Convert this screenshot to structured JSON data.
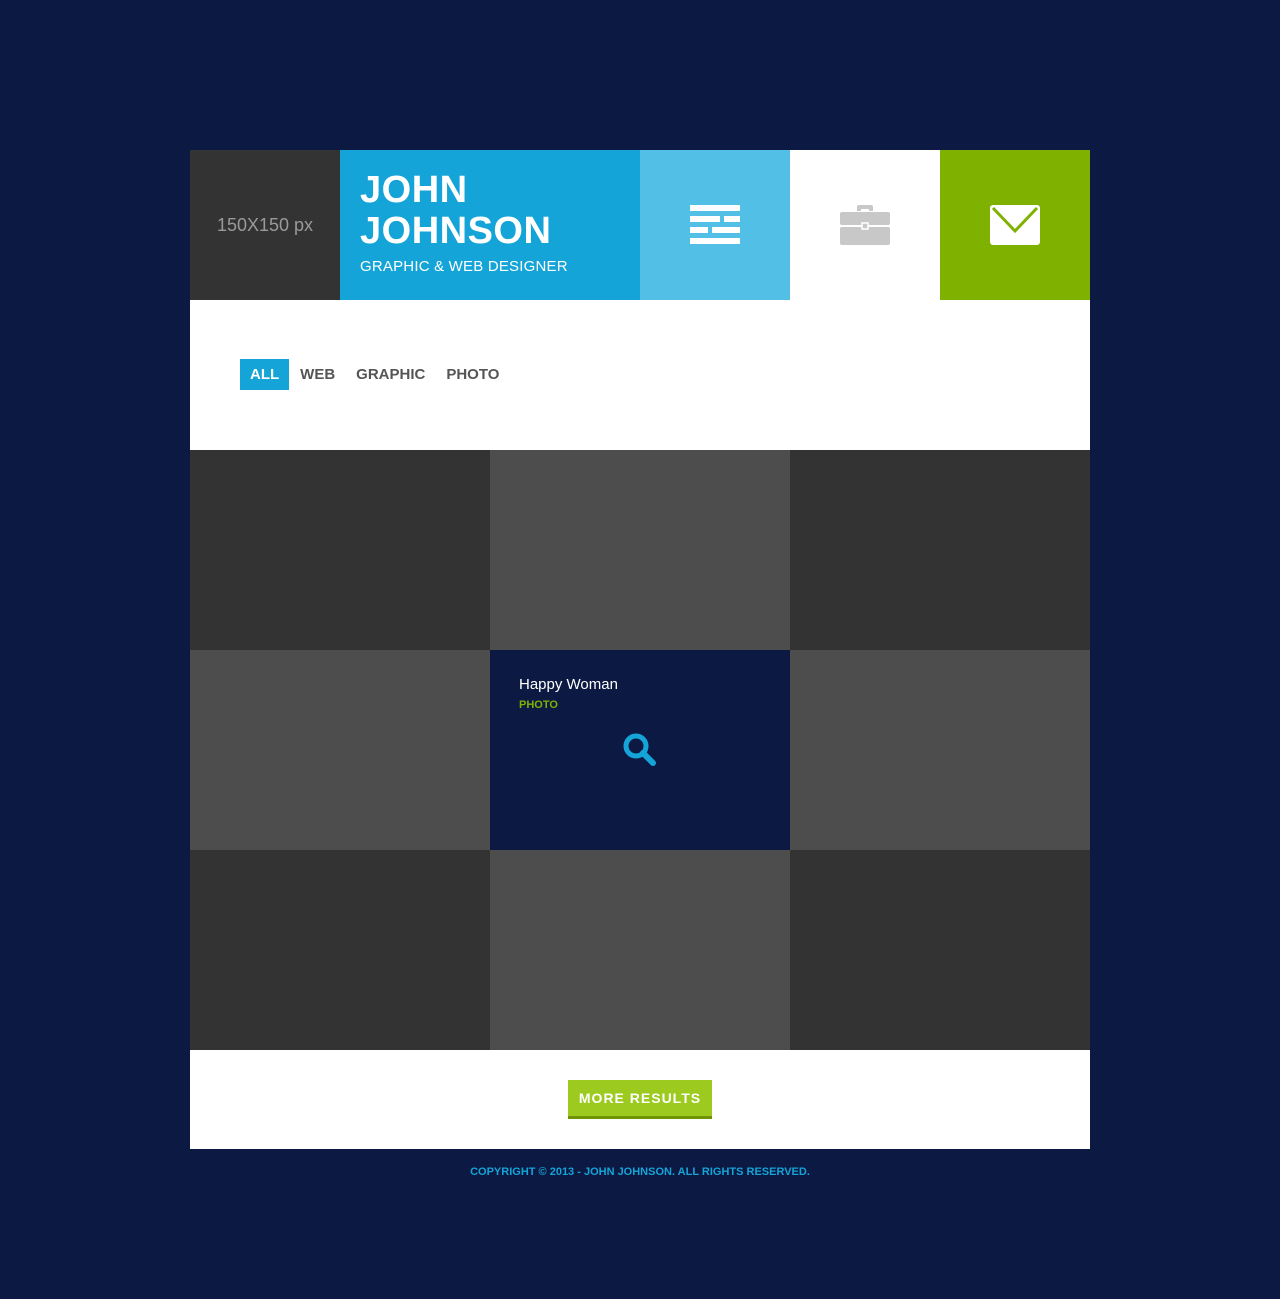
{
  "header": {
    "avatar_placeholder": "150X150 px",
    "name_line1": "JOHN",
    "name_line2": "JOHNSON",
    "subtitle": "GRAPHIC & WEB DESIGNER",
    "nav_icons": [
      "resume-icon",
      "briefcase-icon",
      "envelope-icon"
    ]
  },
  "filters": [
    {
      "label": "ALL",
      "active": true
    },
    {
      "label": "WEB",
      "active": false
    },
    {
      "label": "GRAPHIC",
      "active": false
    },
    {
      "label": "PHOTO",
      "active": false
    }
  ],
  "featured_item": {
    "title": "Happy Woman",
    "category": "PHOTO"
  },
  "more_results_label": "MORE RESULTS",
  "footer": {
    "copyright": "COPYRIGHT © 2013 - JOHN JOHNSON. ALL RIGHTS RESERVED."
  },
  "colors": {
    "background": "#0b1943",
    "blue": "#15a4d7",
    "light_blue": "#52bfe7",
    "green": "#7fb100",
    "button_green": "#9dca1e",
    "dark_tile": "#333333",
    "mid_tile": "#4d4d4d"
  }
}
